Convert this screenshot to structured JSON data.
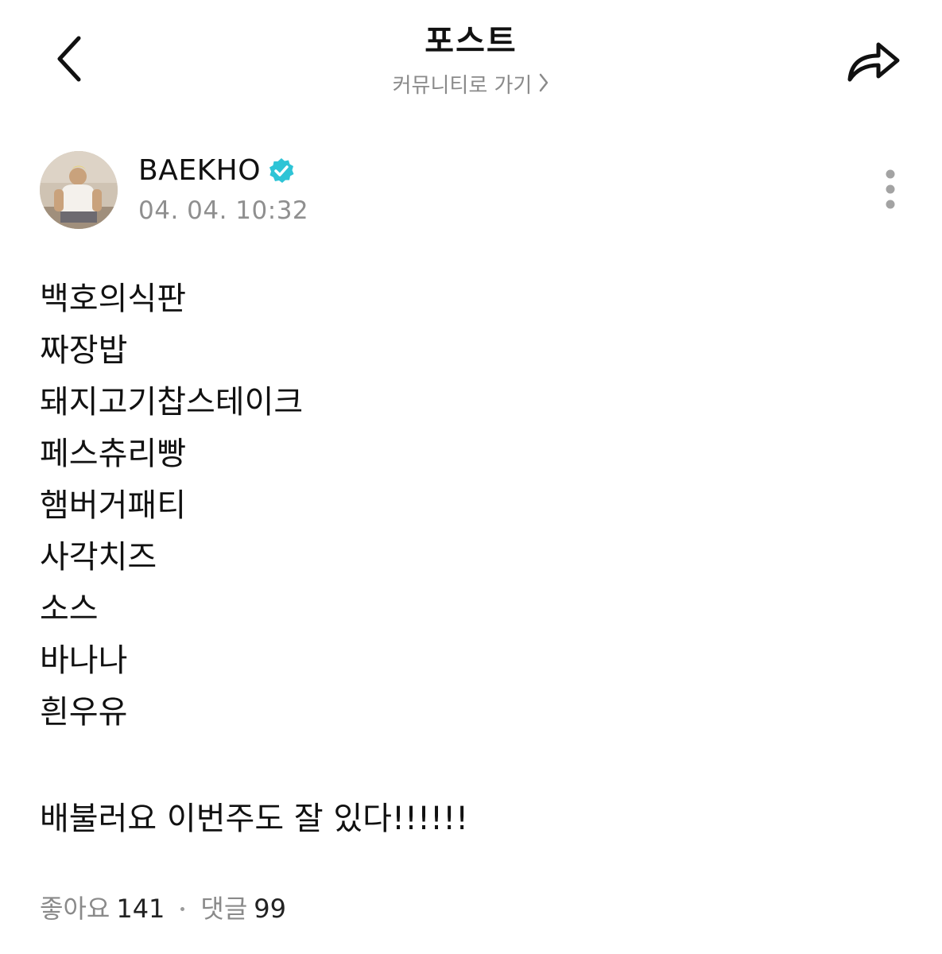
{
  "header": {
    "title": "포스트",
    "community_link": "커뮤니티로 가기",
    "back_icon": "chevron-left-icon",
    "share_icon": "share-arrow-icon"
  },
  "author": {
    "name": "BAEKHO",
    "verified_icon": "verified-badge-icon",
    "verified_color": "#2ec4d6",
    "timestamp": "04. 04. 10:32",
    "more_icon": "more-vertical-icon"
  },
  "post": {
    "lines": [
      "백호의식판",
      "짜장밥",
      "돼지고기찹스테이크",
      "페스츄리빵",
      "햄버거패티",
      "사각치즈",
      "소스",
      "바나나",
      "흰우유"
    ],
    "closing": "배불러요 이번주도 잘 있다!!!!!!"
  },
  "stats": {
    "likes_label": "좋아요",
    "likes_count": "141",
    "comments_label": "댓글",
    "comments_count": "99"
  }
}
